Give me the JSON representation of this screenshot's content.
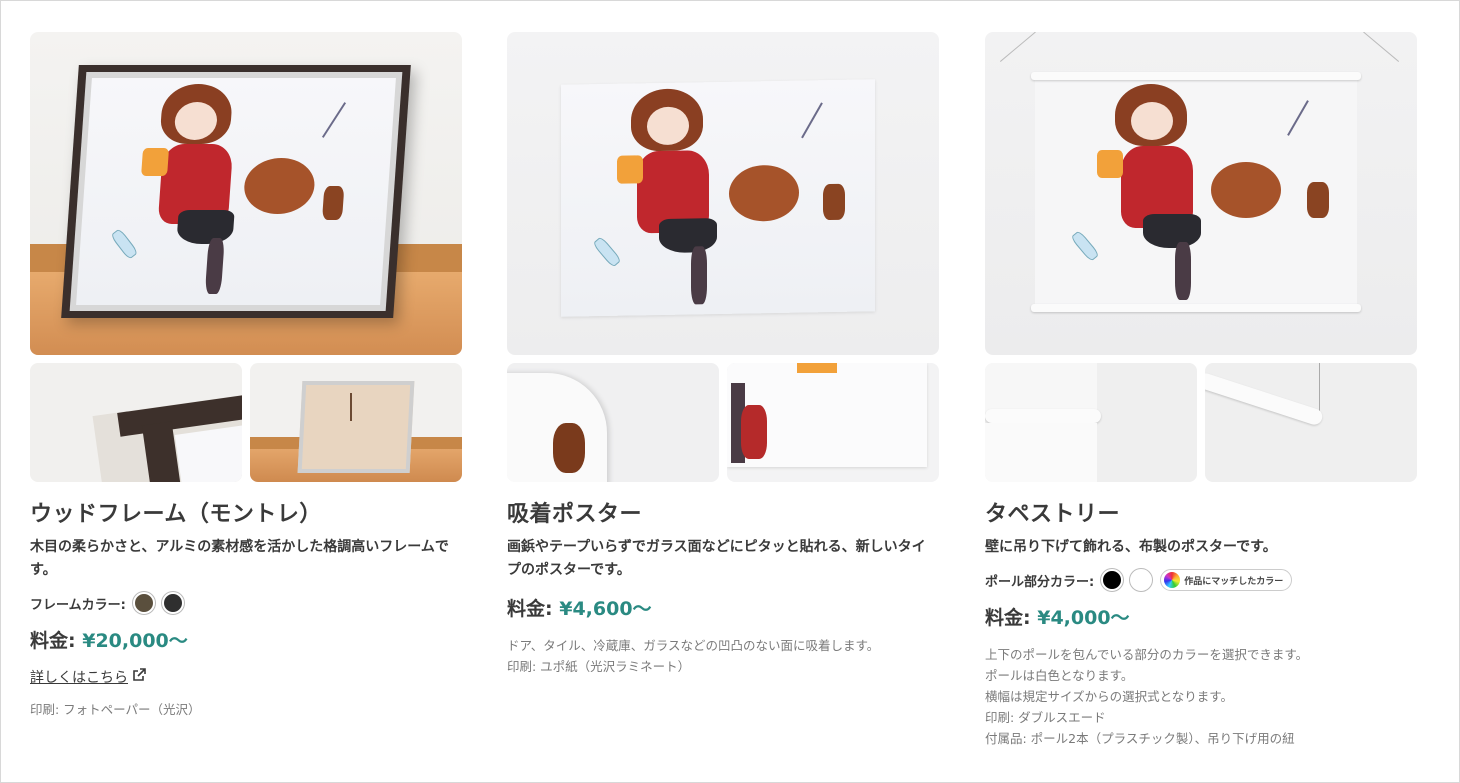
{
  "products": [
    {
      "title": "ウッドフレーム（モントレ）",
      "description": "木目の柔らかさと、アルミの素材感を活かした格調高いフレームです。",
      "color_label": "フレームカラー:",
      "swatches": [
        "#5a4f3d",
        "#2f2f2f"
      ],
      "price_label": "料金:",
      "price_value": "¥20,000〜",
      "link_text": "詳しくはこちら",
      "notes": [
        "印刷: フォトペーパー（光沢）"
      ]
    },
    {
      "title": "吸着ポスター",
      "description": "画鋲やテープいらずでガラス面などにピタッと貼れる、新しいタイプのポスターです。",
      "price_label": "料金:",
      "price_value": "¥4,600〜",
      "notes": [
        "ドア、タイル、冷蔵庫、ガラスなどの凹凸のない面に吸着します。",
        "印刷: ユポ紙（光沢ラミネート）"
      ]
    },
    {
      "title": "タペストリー",
      "description": "壁に吊り下げて飾れる、布製のポスターです。",
      "color_label": "ポール部分カラー:",
      "swatches": [
        "#000000",
        "#ffffff"
      ],
      "match_chip": "作品にマッチしたカラー",
      "price_label": "料金:",
      "price_value": "¥4,000〜",
      "notes": [
        "上下のポールを包んでいる部分のカラーを選択できます。",
        "ポールは白色となります。",
        "横幅は規定サイズからの選択式となります。",
        "印刷: ダブルスエード",
        "付属品: ポール2本（プラスチック製）、吊り下げ用の紐"
      ]
    }
  ],
  "colors": {
    "accent_price": "#2a8a82",
    "text": "#3a3a3a",
    "muted": "#7a7a7a"
  },
  "icons": [
    "external-link-icon",
    "rainbow-palette-icon"
  ]
}
